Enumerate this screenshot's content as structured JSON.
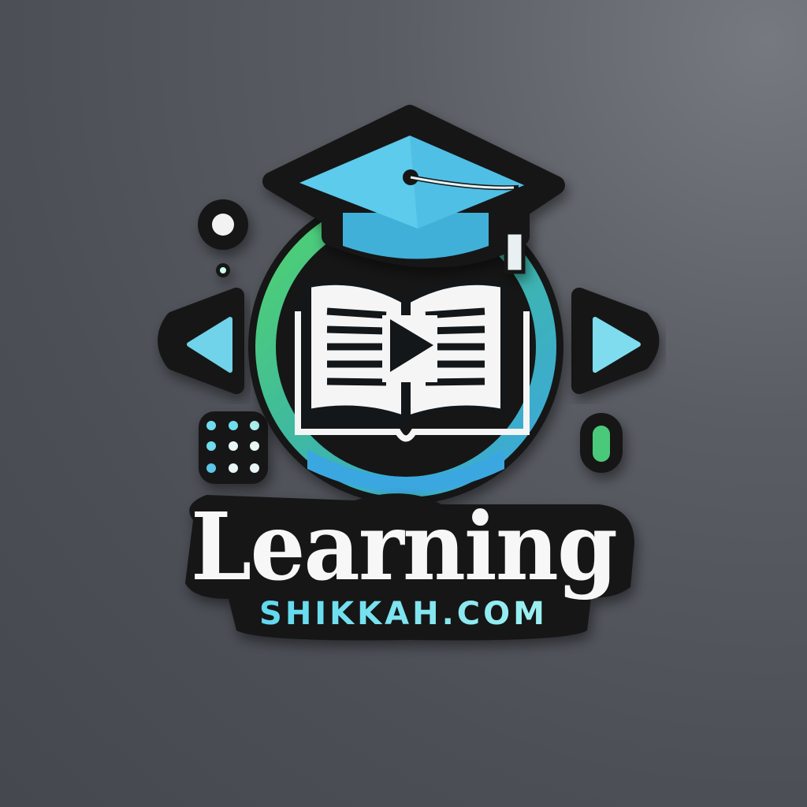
{
  "logo": {
    "title": "Learning",
    "subtitle": "SHIKKAH.COM",
    "icons": [
      "graduation-cap-icon",
      "open-book-icon",
      "play-icon",
      "arrow-left-icon",
      "arrow-right-icon"
    ],
    "colors": {
      "background": "#555860",
      "outline": "#121619",
      "blue": "#4fc3e8",
      "green": "#4cc96a",
      "cyan_text": "#6fe3ee",
      "white": "#f7f7f7"
    }
  }
}
